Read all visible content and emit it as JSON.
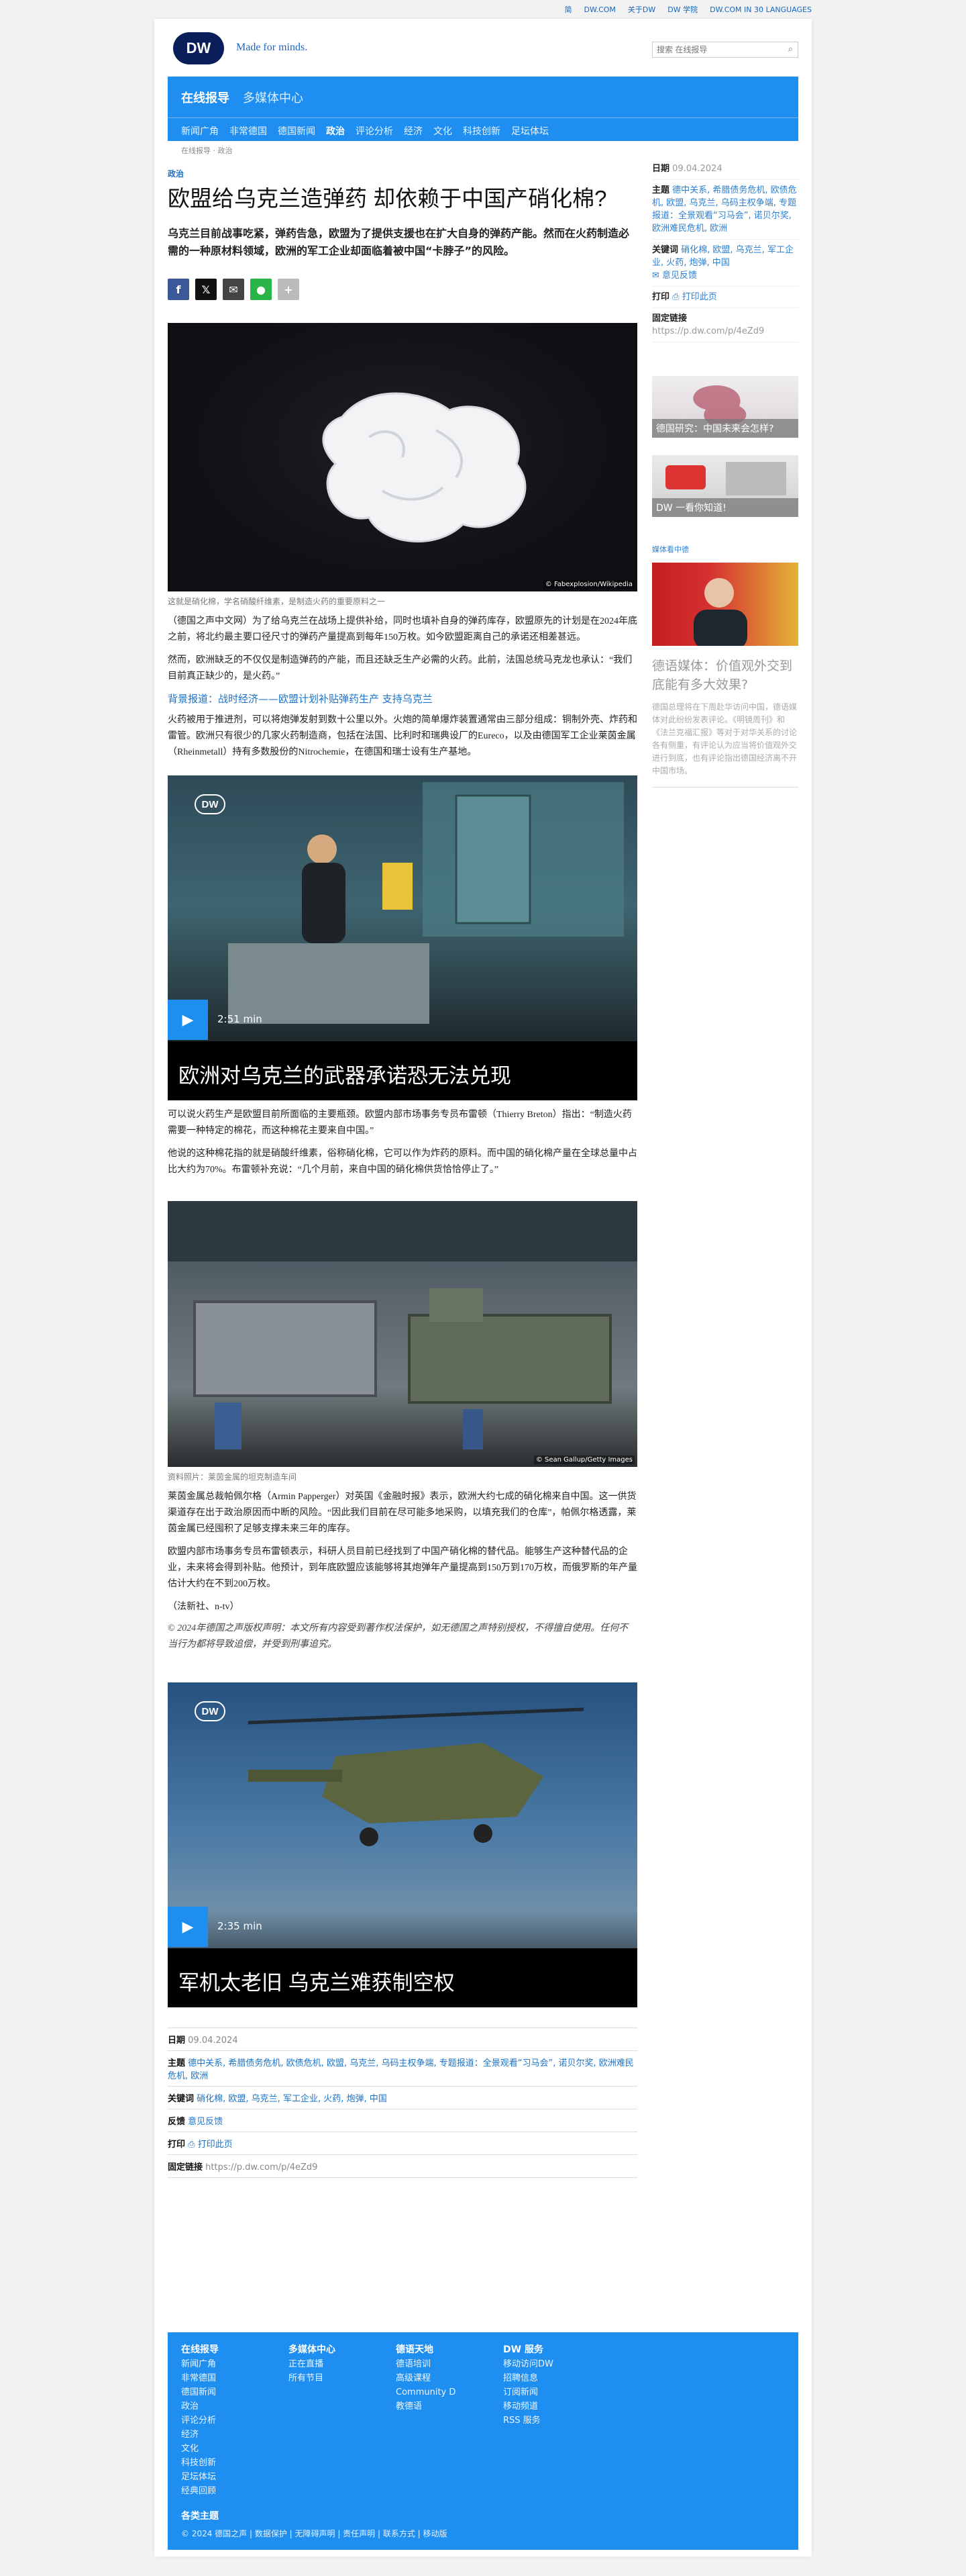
{
  "topbar": [
    "简",
    "DW.COM",
    "关于DW",
    "DW 学院",
    "DW.COM IN 30 LANGUAGES"
  ],
  "header": {
    "logo": "DW",
    "slogan": "Made for minds.",
    "search_placeholder": "搜索 在线报导"
  },
  "bluebar": {
    "primary": "在线报导",
    "secondary": "多媒体中心"
  },
  "nav": [
    "新闻广角",
    "非常德国",
    "德国新闻",
    "政治",
    "评论分析",
    "经济",
    "文化",
    "科技创新",
    "足坛体坛"
  ],
  "breadcrumb": "在线报导 · 政治",
  "article": {
    "kicker": "政治",
    "title": "欧盟给乌克兰造弹药 却依赖于中国产硝化棉?",
    "lead": "乌克兰目前战事吃紧，弹药告急，欧盟为了提供支援也在扩大自身的弹药产能。然而在火药制造必需的一种原材料领域，欧洲的军工企业却面临着被中国“卡脖子”的风险。",
    "photo1_credit": "© Fabexplosion/Wikipedia",
    "photo1_caption": "这就是硝化棉，学名硝酸纤维素，是制造火药的重要原料之一",
    "p1": "（德国之声中文网）为了给乌克兰在战场上提供补给，同时也填补自身的弹药库存，欧盟原先的计划是在2024年底之前，将北约最主要口径尺寸的弹药产量提高到每年150万枚。如今欧盟距离自己的承诺还相差甚远。",
    "p2": "然而，欧洲缺乏的不仅仅是制造弹药的产能，而且还缺乏生产必需的火药。此前，法国总统马克龙也承认：“我们目前真正缺少的，是火药。”",
    "sub1": "背景报道：战时经济——欧盟计划补贴弹药生产 支持乌克兰",
    "p3": "火药被用于推进剂，可以将炮弹发射到数十公里以外。火炮的简单爆炸装置通常由三部分组成：铜制外壳、炸药和雷管。欧洲只有很少的几家火药制造商，包括在法国、比利时和瑞典设厂的Eureco，以及由德国军工企业莱茵金属（Rheinmetall）持有多数股份的Nitrochemie，在德国和瑞士设有生产基地。",
    "video1_duration": "2:51 min",
    "video1_title": "欧洲对乌克兰的武器承诺恐无法兑现",
    "p4": "可以说火药生产是欧盟目前所面临的主要瓶颈。欧盟内部市场事务专员布雷顿（Thierry Breton）指出：“制造火药需要一种特定的棉花，而这种棉花主要来自中国。”",
    "p5": "他说的这种棉花指的就是硝酸纤维素，俗称硝化棉，它可以作为炸药的原料。而中国的硝化棉产量在全球总量中占比大约为70%。布雷顿补充说：“几个月前，来自中国的硝化棉供货恰恰停止了。”",
    "photo2_credit": "© Sean Gallup/Getty Images",
    "photo2_caption": "资料照片：莱茵金属的坦克制造车间",
    "p6": "莱茵金属总裁帕佩尔格（Armin Papperger）对英国《金融时报》表示，欧洲大约七成的硝化棉来自中国。这一供货渠道存在出于政治原因而中断的风险。“因此我们目前在尽可能多地采购，以填充我们的仓库”，帕佩尔格透露，莱茵金属已经囤积了足够支撑未来三年的库存。",
    "p7": "欧盟内部市场事务专员布雷顿表示，科研人员目前已经找到了中国产硝化棉的替代品。能够生产这种替代品的企业，未来将会得到补贴。他预计，到年底欧盟应该能够将其炮弹年产量提高到150万到170万枚，而俄罗斯的年产量估计大约在不到200万枚。",
    "p8": "（法新社、n-tv）",
    "copyright": "© 2024年德国之声版权声明：本文所有内容受到著作权法保护，如无德国之声特别授权，不得擅自使用。任何不当行为都将导致追偿，并受到刑事追究。",
    "video2_duration": "2:35 min",
    "video2_title": "军机太老旧 乌克兰难获制空权"
  },
  "meta": {
    "date_label": "日期",
    "date": "09.04.2024",
    "topics_label": "主题",
    "topics": "德中关系, 希腊债务危机, 欧债危机, 欧盟, 乌克兰, 乌码主权争端, 专题报道：全景观看“习马会”, 诺贝尔奖, 欧洲难民危机, 欧洲",
    "keywords_label": "关键词",
    "keywords": "硝化棉, 欧盟, 乌克兰, 军工企业, 火药, 炮弹, 中国",
    "feedback_label": "反馈",
    "feedback": "意见反馈",
    "print_label": "打印",
    "print": "打印此页",
    "link_label": "固定链接",
    "link": "https://p.dw.com/p/4eZd9"
  },
  "side": {
    "date_label": "日期",
    "date": "09.04.2024",
    "topics_label": "主题",
    "topics": "德中关系, 希腊债务危机, 欧债危机, 欧盟, 乌克兰, 乌码主权争端, 专题报道：全景观看“习马会”, 诺贝尔奖, 欧洲难民危机, 欧洲",
    "keywords_label": "关键词",
    "keywords": "硝化棉, 欧盟, 乌克兰, 军工企业, 火药, 炮弹, 中国",
    "feedback": "意见反馈",
    "print_label": "打印",
    "print": "打印此页",
    "link_label": "固定链接",
    "link": "https://p.dw.com/p/4eZd9",
    "teaser1": "德国研究：中国未来会怎样?",
    "teaser2": "DW 一看你知道!",
    "section_label": "媒体看中德",
    "story_title": "德语媒体：价值观外交到底能有多大效果?",
    "story_text": "德国总理将在下周赴华访问中国，德语媒体对此纷纷发表评论。《明镜周刊》和《法兰克福汇报》等对于对华关系的讨论各有侧重，有评论认为应当将价值观外交进行到底，也有评论指出德国经济离不开中国市场。"
  },
  "footer": {
    "cols": [
      {
        "title": "在线报导",
        "items": [
          "新闻广角",
          "非常德国",
          "德国新闻",
          "政治",
          "评论分析",
          "经济",
          "文化",
          "科技创新",
          "足坛体坛",
          "经典回顾"
        ]
      },
      {
        "title": "多媒体中心",
        "items": [
          "正在直播",
          "所有节目"
        ]
      },
      {
        "title": "德语天地",
        "items": [
          "德语培训",
          "高级课程",
          "Community D",
          "教德语"
        ]
      },
      {
        "title": "DW 服务",
        "items": [
          "移动访问DW",
          "招聘信息",
          "订阅新闻",
          "移动频道",
          "RSS 服务"
        ]
      }
    ],
    "more": "各类主题",
    "copyright": "© 2024 德国之声 | 数据保护 | 无障碍声明 | 责任声明 | 联系方式 | 移动版"
  },
  "colors": {
    "brand_blue": "#1f8ef1",
    "link": "#1a73c9",
    "dw_navy": "#0a1e5a"
  }
}
